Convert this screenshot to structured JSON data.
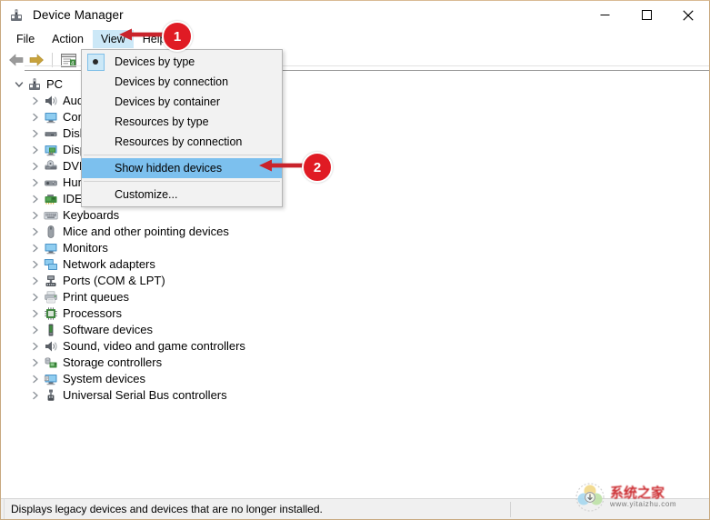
{
  "window": {
    "title": "Device Manager",
    "icon": "device-manager-icon",
    "caption_buttons": [
      {
        "name": "minimize-button",
        "glyph": "—"
      },
      {
        "name": "maximize-button",
        "glyph": "□"
      },
      {
        "name": "close-button",
        "glyph": "✕"
      }
    ]
  },
  "menubar": {
    "items": [
      {
        "label": "File",
        "name": "menu-file",
        "active": false
      },
      {
        "label": "Action",
        "name": "menu-action",
        "active": false
      },
      {
        "label": "View",
        "name": "menu-view",
        "active": true
      },
      {
        "label": "Help",
        "name": "menu-help",
        "active": false
      }
    ]
  },
  "toolbar": {
    "buttons": [
      {
        "name": "back-button",
        "icon": "back-arrow-icon"
      },
      {
        "name": "forward-button",
        "icon": "forward-arrow-icon"
      },
      {
        "name": "properties-button",
        "icon": "properties-icon"
      }
    ]
  },
  "view_menu": {
    "items": [
      {
        "label": "Devices by type",
        "name": "view-devices-by-type",
        "selected": true,
        "highlighted": false,
        "separator_after": false
      },
      {
        "label": "Devices by connection",
        "name": "view-devices-by-connection",
        "selected": false,
        "highlighted": false,
        "separator_after": false
      },
      {
        "label": "Devices by container",
        "name": "view-devices-by-container",
        "selected": false,
        "highlighted": false,
        "separator_after": false
      },
      {
        "label": "Resources by type",
        "name": "view-resources-by-type",
        "selected": false,
        "highlighted": false,
        "separator_after": false
      },
      {
        "label": "Resources by connection",
        "name": "view-resources-by-connection",
        "selected": false,
        "highlighted": false,
        "separator_after": true
      },
      {
        "label": "Show hidden devices",
        "name": "view-show-hidden-devices",
        "selected": false,
        "highlighted": true,
        "separator_after": true
      },
      {
        "label": "Customize...",
        "name": "view-customize",
        "selected": false,
        "highlighted": false,
        "separator_after": false
      }
    ]
  },
  "tree": {
    "root": {
      "label": "PC",
      "name": "tree-node-pc",
      "icon": "computer-icon",
      "expanded": true
    },
    "items": [
      {
        "label": "Audio inputs and outputs",
        "name": "tree-node-audio",
        "icon": "speaker-icon"
      },
      {
        "label": "Computer",
        "name": "tree-node-computer",
        "icon": "monitor-icon"
      },
      {
        "label": "Disk drives",
        "name": "tree-node-disk-drives",
        "icon": "disk-icon"
      },
      {
        "label": "Display adapters",
        "name": "tree-node-display-adapters",
        "icon": "display-adapter-icon"
      },
      {
        "label": "DVD/CD-ROM drives",
        "name": "tree-node-dvd-cdrom",
        "icon": "dvd-icon"
      },
      {
        "label": "Human Interface Devices",
        "name": "tree-node-hid",
        "icon": "hid-icon"
      },
      {
        "label": "IDE ATA/ATAPI controllers",
        "name": "tree-node-ide-ata",
        "icon": "ide-icon"
      },
      {
        "label": "Keyboards",
        "name": "tree-node-keyboards",
        "icon": "keyboard-icon"
      },
      {
        "label": "Mice and other pointing devices",
        "name": "tree-node-mice",
        "icon": "mouse-icon"
      },
      {
        "label": "Monitors",
        "name": "tree-node-monitors",
        "icon": "monitor-icon"
      },
      {
        "label": "Network adapters",
        "name": "tree-node-network-adapters",
        "icon": "network-icon"
      },
      {
        "label": "Ports (COM & LPT)",
        "name": "tree-node-ports",
        "icon": "port-icon"
      },
      {
        "label": "Print queues",
        "name": "tree-node-print-queues",
        "icon": "printer-icon"
      },
      {
        "label": "Processors",
        "name": "tree-node-processors",
        "icon": "processor-icon"
      },
      {
        "label": "Software devices",
        "name": "tree-node-software-devices",
        "icon": "software-device-icon"
      },
      {
        "label": "Sound, video and game controllers",
        "name": "tree-node-sound-video-game",
        "icon": "speaker-icon"
      },
      {
        "label": "Storage controllers",
        "name": "tree-node-storage-controllers",
        "icon": "storage-controller-icon"
      },
      {
        "label": "System devices",
        "name": "tree-node-system-devices",
        "icon": "system-device-icon"
      },
      {
        "label": "Universal Serial Bus controllers",
        "name": "tree-node-usb-controllers",
        "icon": "usb-icon"
      }
    ]
  },
  "statusbar": {
    "text": "Displays legacy devices and devices that are no longer installed."
  },
  "annotations": [
    {
      "number": "1",
      "name": "annotation-badge-1",
      "target": "menu-view"
    },
    {
      "number": "2",
      "name": "annotation-badge-2",
      "target": "view-show-hidden-devices"
    }
  ],
  "watermark": {
    "chinese": "系统之家",
    "url": "www.yitaizhu.com"
  },
  "colors": {
    "accent_highlight": "#7cc0ee",
    "menu_active": "#cce8f7",
    "annotation_red": "#e01b24",
    "window_border": "#c8a980"
  }
}
